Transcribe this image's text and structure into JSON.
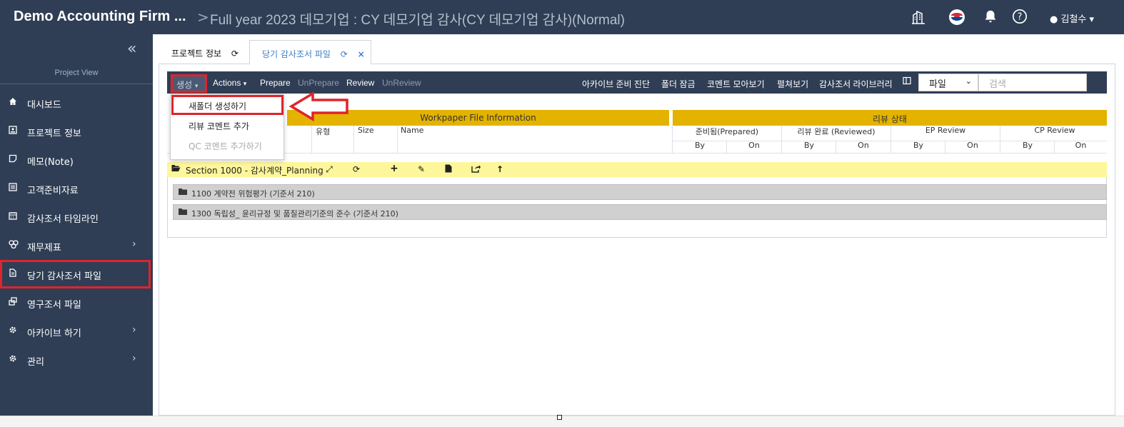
{
  "header": {
    "firm": "Demo Accounting Firm ...",
    "separator": ">",
    "project_title": "Full year 2023 데모기업 : CY 데모기업 감사(CY 데모기업 감사)(Normal)",
    "user_name": "김철수"
  },
  "sidebar": {
    "collapse_glyph": "«",
    "view_label": "Project View",
    "items": [
      {
        "label": "대시보드",
        "icon": "home-icon"
      },
      {
        "label": "프로젝트 정보",
        "icon": "info-card-icon"
      },
      {
        "label": "메모(Note)",
        "icon": "note-icon"
      },
      {
        "label": "고객준비자료",
        "icon": "list-icon"
      },
      {
        "label": "감사조서 타임라인",
        "icon": "calendar-icon"
      },
      {
        "label": "재무제표",
        "icon": "coins-icon",
        "has_children": true
      },
      {
        "label": "당기 감사조서 파일",
        "icon": "file-icon",
        "highlighted": true
      },
      {
        "label": "영구조서 파일",
        "icon": "copy-icon"
      },
      {
        "label": "아카이브 하기",
        "icon": "gear-icon",
        "has_children": true
      },
      {
        "label": "관리",
        "icon": "gear-icon",
        "has_children": true
      }
    ]
  },
  "tabs": [
    {
      "label": "프로젝트 정보",
      "active": false
    },
    {
      "label": "당기 감사조서 파일",
      "active": true
    }
  ],
  "toolbar": {
    "create": "생성",
    "actions": "Actions",
    "prepare": "Prepare",
    "unprepare": "UnPrepare",
    "review": "Review",
    "unreview": "UnReview",
    "right": [
      "아카이브 준비 진단",
      "폴더 잠금",
      "코멘트 모아보기",
      "펼쳐보기",
      "감사조서 라이브러리"
    ],
    "select_value": "파일",
    "search_placeholder": "검색"
  },
  "dropdown": {
    "items": [
      {
        "label": "새폴더 생성하기",
        "enabled": true,
        "highlighted": true
      },
      {
        "label": "리뷰 코멘트 추가",
        "enabled": true
      },
      {
        "label": "QC 코멘트 추가하기",
        "enabled": false
      }
    ]
  },
  "grid": {
    "group_left": "Workpaper File Information",
    "group_right": "리뷰 상태",
    "columns_left": [
      "유형",
      "Size",
      "Name"
    ],
    "review_columns": [
      "준비됨(Prepared)",
      "리뷰 완료 (Reviewed)",
      "EP Review",
      "CP Review"
    ],
    "by_label": "By",
    "on_label": "On"
  },
  "section": {
    "label": "Section 1000 - 감사계약_Planning",
    "folders": [
      "1100 계약전 위험평가 (기준서 210)",
      "1300 독립성_ 윤리규정 및 품질관리기준의 준수 (기준서 210)"
    ]
  },
  "colors": {
    "navy": "#2f3e55",
    "gold_header": "#e3b300",
    "section_yellow": "#fef69a",
    "folder_grey": "#d0d0d0",
    "highlight_red": "#e0242b",
    "tab_blue": "#3c7fc4"
  }
}
